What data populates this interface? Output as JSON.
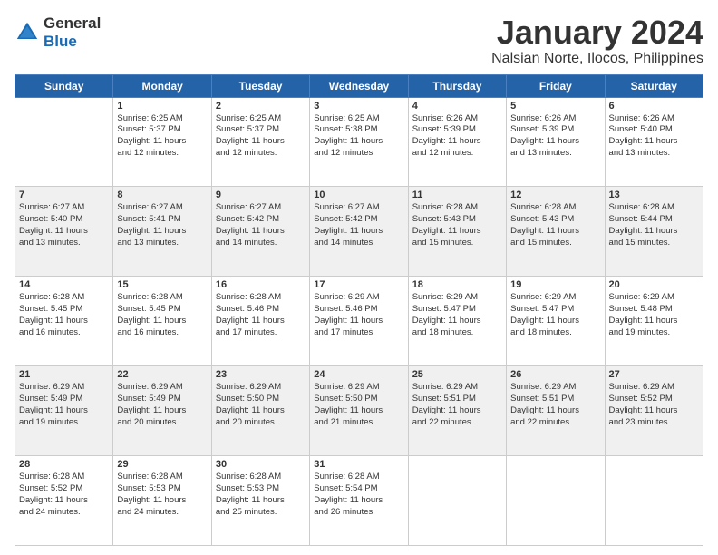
{
  "header": {
    "logo": {
      "general": "General",
      "blue": "Blue"
    },
    "title": "January 2024",
    "location": "Nalsian Norte, Ilocos, Philippines"
  },
  "days_of_week": [
    "Sunday",
    "Monday",
    "Tuesday",
    "Wednesday",
    "Thursday",
    "Friday",
    "Saturday"
  ],
  "weeks": [
    [
      {
        "day": "",
        "info": ""
      },
      {
        "day": "1",
        "info": "Sunrise: 6:25 AM\nSunset: 5:37 PM\nDaylight: 11 hours\nand 12 minutes."
      },
      {
        "day": "2",
        "info": "Sunrise: 6:25 AM\nSunset: 5:37 PM\nDaylight: 11 hours\nand 12 minutes."
      },
      {
        "day": "3",
        "info": "Sunrise: 6:25 AM\nSunset: 5:38 PM\nDaylight: 11 hours\nand 12 minutes."
      },
      {
        "day": "4",
        "info": "Sunrise: 6:26 AM\nSunset: 5:39 PM\nDaylight: 11 hours\nand 12 minutes."
      },
      {
        "day": "5",
        "info": "Sunrise: 6:26 AM\nSunset: 5:39 PM\nDaylight: 11 hours\nand 13 minutes."
      },
      {
        "day": "6",
        "info": "Sunrise: 6:26 AM\nSunset: 5:40 PM\nDaylight: 11 hours\nand 13 minutes."
      }
    ],
    [
      {
        "day": "7",
        "info": "Sunrise: 6:27 AM\nSunset: 5:40 PM\nDaylight: 11 hours\nand 13 minutes."
      },
      {
        "day": "8",
        "info": "Sunrise: 6:27 AM\nSunset: 5:41 PM\nDaylight: 11 hours\nand 13 minutes."
      },
      {
        "day": "9",
        "info": "Sunrise: 6:27 AM\nSunset: 5:42 PM\nDaylight: 11 hours\nand 14 minutes."
      },
      {
        "day": "10",
        "info": "Sunrise: 6:27 AM\nSunset: 5:42 PM\nDaylight: 11 hours\nand 14 minutes."
      },
      {
        "day": "11",
        "info": "Sunrise: 6:28 AM\nSunset: 5:43 PM\nDaylight: 11 hours\nand 15 minutes."
      },
      {
        "day": "12",
        "info": "Sunrise: 6:28 AM\nSunset: 5:43 PM\nDaylight: 11 hours\nand 15 minutes."
      },
      {
        "day": "13",
        "info": "Sunrise: 6:28 AM\nSunset: 5:44 PM\nDaylight: 11 hours\nand 15 minutes."
      }
    ],
    [
      {
        "day": "14",
        "info": "Sunrise: 6:28 AM\nSunset: 5:45 PM\nDaylight: 11 hours\nand 16 minutes."
      },
      {
        "day": "15",
        "info": "Sunrise: 6:28 AM\nSunset: 5:45 PM\nDaylight: 11 hours\nand 16 minutes."
      },
      {
        "day": "16",
        "info": "Sunrise: 6:28 AM\nSunset: 5:46 PM\nDaylight: 11 hours\nand 17 minutes."
      },
      {
        "day": "17",
        "info": "Sunrise: 6:29 AM\nSunset: 5:46 PM\nDaylight: 11 hours\nand 17 minutes."
      },
      {
        "day": "18",
        "info": "Sunrise: 6:29 AM\nSunset: 5:47 PM\nDaylight: 11 hours\nand 18 minutes."
      },
      {
        "day": "19",
        "info": "Sunrise: 6:29 AM\nSunset: 5:47 PM\nDaylight: 11 hours\nand 18 minutes."
      },
      {
        "day": "20",
        "info": "Sunrise: 6:29 AM\nSunset: 5:48 PM\nDaylight: 11 hours\nand 19 minutes."
      }
    ],
    [
      {
        "day": "21",
        "info": "Sunrise: 6:29 AM\nSunset: 5:49 PM\nDaylight: 11 hours\nand 19 minutes."
      },
      {
        "day": "22",
        "info": "Sunrise: 6:29 AM\nSunset: 5:49 PM\nDaylight: 11 hours\nand 20 minutes."
      },
      {
        "day": "23",
        "info": "Sunrise: 6:29 AM\nSunset: 5:50 PM\nDaylight: 11 hours\nand 20 minutes."
      },
      {
        "day": "24",
        "info": "Sunrise: 6:29 AM\nSunset: 5:50 PM\nDaylight: 11 hours\nand 21 minutes."
      },
      {
        "day": "25",
        "info": "Sunrise: 6:29 AM\nSunset: 5:51 PM\nDaylight: 11 hours\nand 22 minutes."
      },
      {
        "day": "26",
        "info": "Sunrise: 6:29 AM\nSunset: 5:51 PM\nDaylight: 11 hours\nand 22 minutes."
      },
      {
        "day": "27",
        "info": "Sunrise: 6:29 AM\nSunset: 5:52 PM\nDaylight: 11 hours\nand 23 minutes."
      }
    ],
    [
      {
        "day": "28",
        "info": "Sunrise: 6:28 AM\nSunset: 5:52 PM\nDaylight: 11 hours\nand 24 minutes."
      },
      {
        "day": "29",
        "info": "Sunrise: 6:28 AM\nSunset: 5:53 PM\nDaylight: 11 hours\nand 24 minutes."
      },
      {
        "day": "30",
        "info": "Sunrise: 6:28 AM\nSunset: 5:53 PM\nDaylight: 11 hours\nand 25 minutes."
      },
      {
        "day": "31",
        "info": "Sunrise: 6:28 AM\nSunset: 5:54 PM\nDaylight: 11 hours\nand 26 minutes."
      },
      {
        "day": "",
        "info": ""
      },
      {
        "day": "",
        "info": ""
      },
      {
        "day": "",
        "info": ""
      }
    ]
  ]
}
